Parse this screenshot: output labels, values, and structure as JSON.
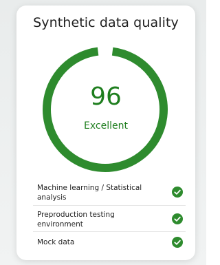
{
  "card": {
    "title": "Synthetic data quality",
    "score": "96",
    "rating": "Excellent",
    "score_value": 96,
    "score_max": 100
  },
  "colors": {
    "accent": "#2e8b2e",
    "accent_text": "#1e7e1e",
    "check": "#2e8b2e"
  },
  "features": [
    {
      "label": "Machine learning / Statistical analysis",
      "icon": "check-circle-icon"
    },
    {
      "label": "Preproduction testing environment",
      "icon": "check-circle-icon"
    },
    {
      "label": "Mock data",
      "icon": "check-circle-icon"
    }
  ]
}
